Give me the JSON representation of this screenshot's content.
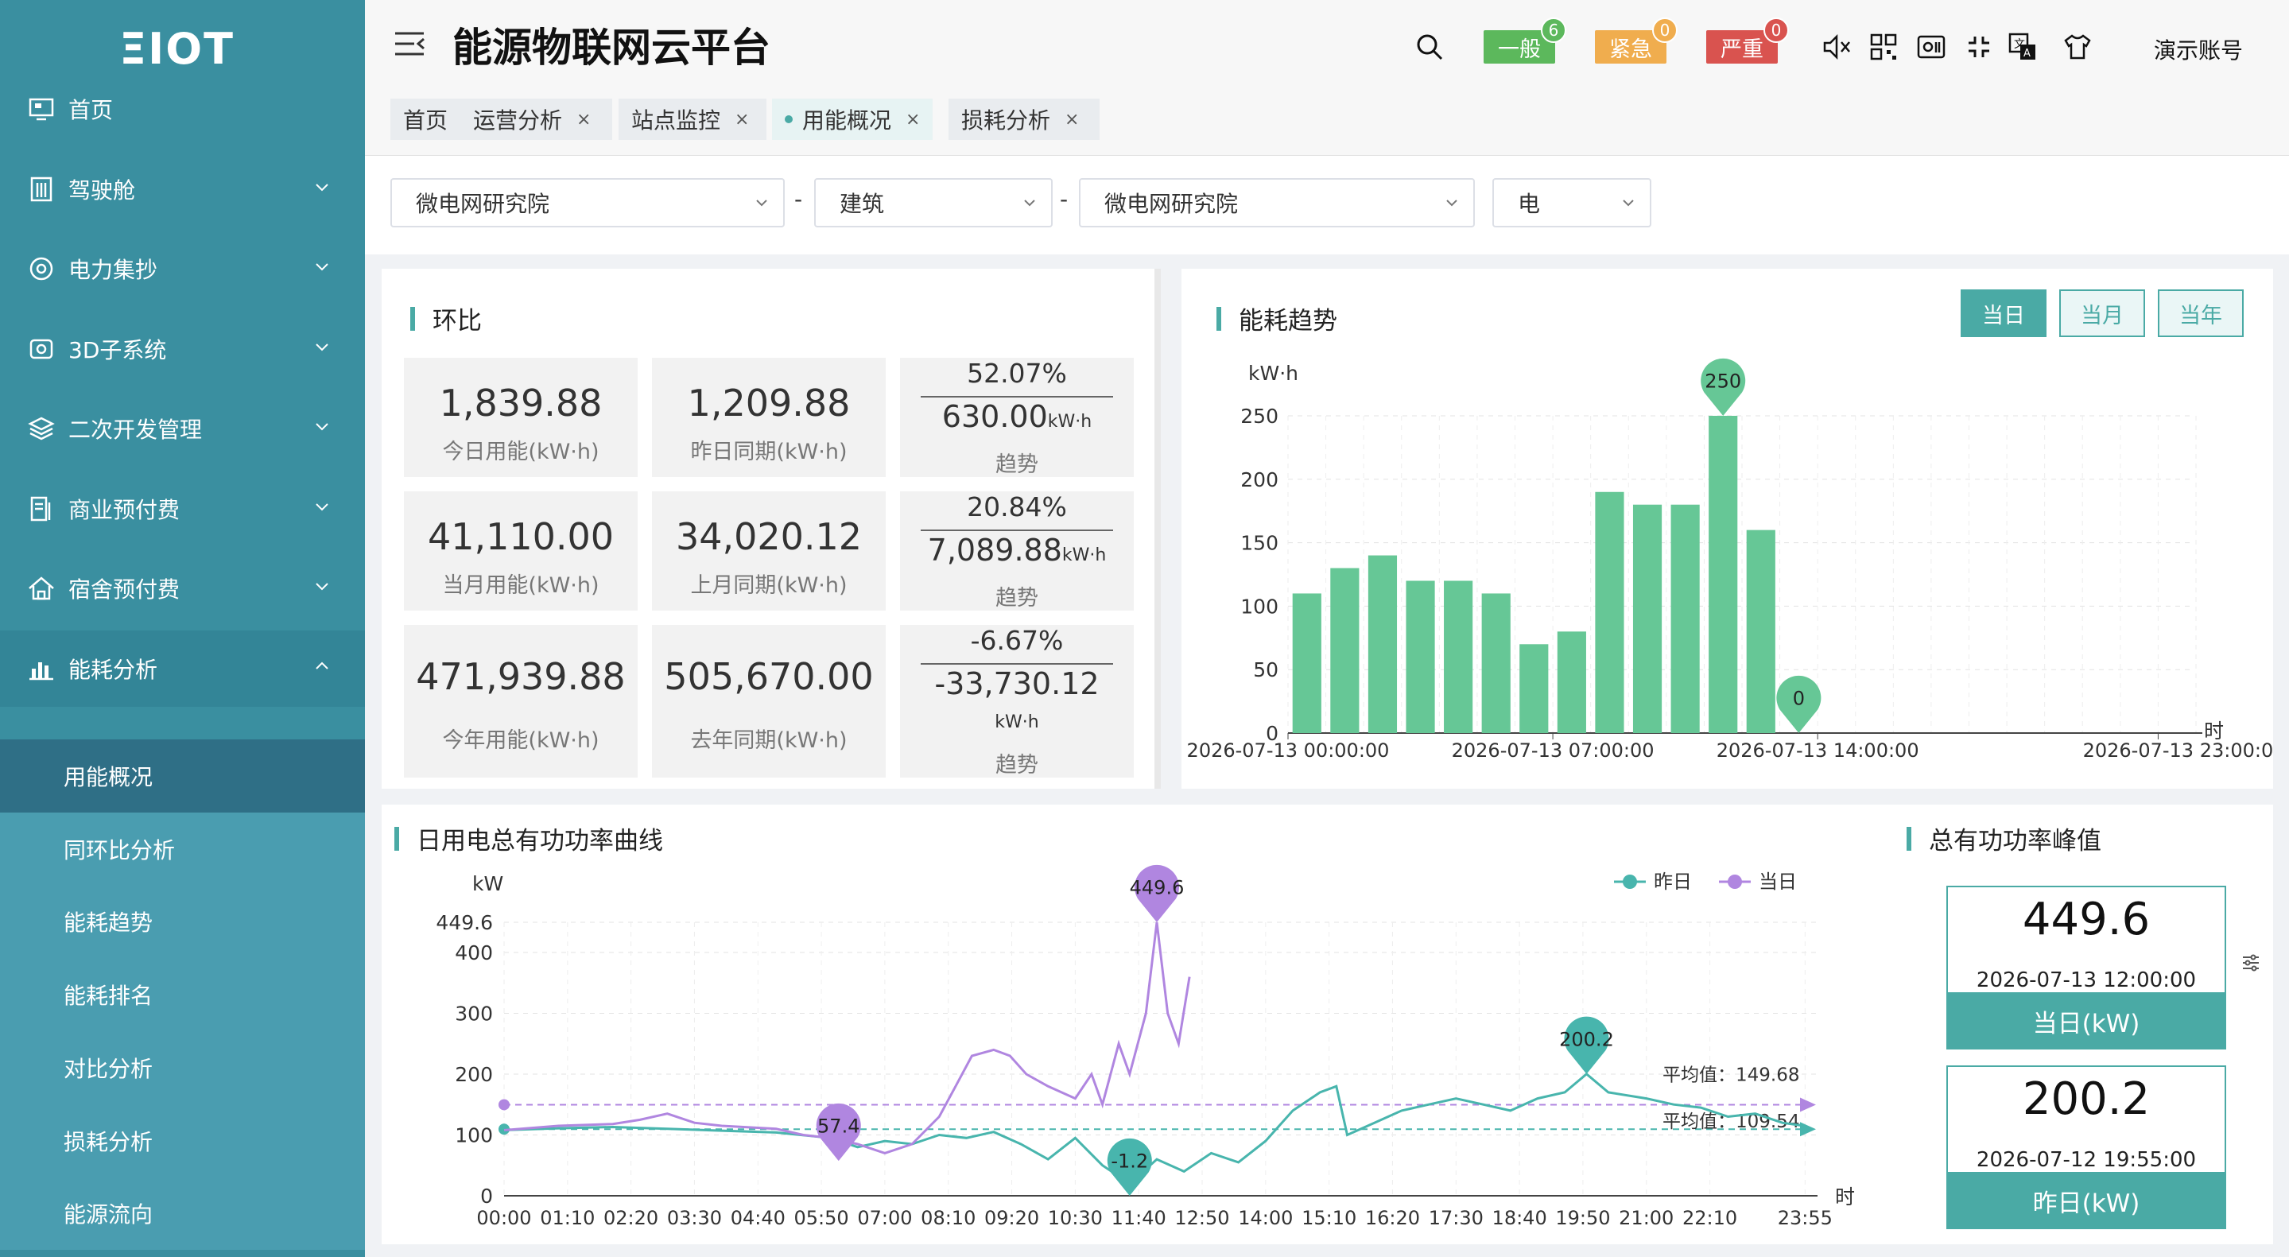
{
  "sidebar": {
    "logo": "ΞIOT",
    "menu": [
      {
        "label": "首页",
        "icon": "monitor-icon",
        "expandable": false
      },
      {
        "label": "驾驶舱",
        "icon": "building-icon",
        "expandable": true
      },
      {
        "label": "电力集抄",
        "icon": "meter-icon",
        "expandable": true
      },
      {
        "label": "3D子系统",
        "icon": "cube-icon",
        "expandable": true
      },
      {
        "label": "二次开发管理",
        "icon": "layers-icon",
        "expandable": true
      },
      {
        "label": "商业预付费",
        "icon": "invoice-icon",
        "expandable": true
      },
      {
        "label": "宿舍预付费",
        "icon": "home-icon",
        "expandable": true
      },
      {
        "label": "能耗分析",
        "icon": "bar-chart-icon",
        "expandable": true,
        "expanded": true
      }
    ],
    "submenu": [
      {
        "label": "用能概况",
        "active": true
      },
      {
        "label": "同环比分析"
      },
      {
        "label": "能耗趋势"
      },
      {
        "label": "能耗排名"
      },
      {
        "label": "对比分析"
      },
      {
        "label": "损耗分析"
      },
      {
        "label": "能源流向"
      }
    ]
  },
  "header": {
    "title": "能源物联网云平台",
    "alarms": [
      {
        "label": "一般",
        "count": "6",
        "color": "#5cb85c"
      },
      {
        "label": "紧急",
        "count": "0",
        "color": "#f0ad4e"
      },
      {
        "label": "严重",
        "count": "0",
        "color": "#d9534f"
      }
    ],
    "account": "演示账号",
    "tabs": [
      {
        "label": "首页",
        "closable": false
      },
      {
        "label": "运营分析",
        "closable": true
      },
      {
        "label": "站点监控",
        "closable": true
      },
      {
        "label": "用能概况",
        "closable": true,
        "active": true
      },
      {
        "label": "损耗分析",
        "closable": true
      }
    ]
  },
  "filters": {
    "site": "微电网研究院",
    "type": "建筑",
    "building": "微电网研究院",
    "energy": "电",
    "separator": "-"
  },
  "ratio": {
    "title": "环比",
    "rows": [
      {
        "cur_value": "1,839.88",
        "cur_label": "今日用能(kW·h)",
        "prev_value": "1,209.88",
        "prev_label": "昨日同期(kW·h)",
        "pct": "52.07%",
        "diff": "630.00",
        "unit": "kW·h",
        "trend_label": "趋势"
      },
      {
        "cur_value": "41,110.00",
        "cur_label": "当月用能(kW·h)",
        "prev_value": "34,020.12",
        "prev_label": "上月同期(kW·h)",
        "pct": "20.84%",
        "diff": "7,089.88",
        "unit": "kW·h",
        "trend_label": "趋势"
      },
      {
        "cur_value": "471,939.88",
        "cur_label": "今年用能(kW·h)",
        "prev_value": "505,670.00",
        "prev_label": "去年同期(kW·h)",
        "pct": "-6.67%",
        "diff": "-33,730.12",
        "unit": "kW·h",
        "trend_label": "趋势"
      }
    ]
  },
  "trend": {
    "title": "能耗趋势",
    "buttons": [
      "当日",
      "当月",
      "当年"
    ],
    "selected": "当日"
  },
  "power": {
    "title": "日用电总有功功率曲线"
  },
  "peak": {
    "title": "总有功功率峰值",
    "cards": [
      {
        "value": "449.6",
        "time": "2026-07-13 12:00:00",
        "label": "当日(kW)"
      },
      {
        "value": "200.2",
        "time": "2026-07-12 19:55:00",
        "label": "昨日(kW)"
      }
    ]
  },
  "chart_data": [
    {
      "type": "bar",
      "title": "能耗趋势",
      "ylabel": "kW·h",
      "xlabel": "时",
      "ylim": [
        0,
        250
      ],
      "yticks": [
        0,
        50,
        100,
        150,
        200,
        250
      ],
      "x_tick_labels": [
        "2026-07-13 00:00:00",
        "2026-07-13 07:00:00",
        "2026-07-13 14:00:00",
        "2026-07-13 23:00:0"
      ],
      "hours": [
        0,
        1,
        2,
        3,
        4,
        5,
        6,
        7,
        8,
        9,
        10,
        11,
        12,
        13,
        14,
        15,
        16,
        17,
        18,
        19,
        20,
        21,
        22,
        23
      ],
      "values": [
        110,
        130,
        140,
        120,
        120,
        110,
        70,
        80,
        190,
        180,
        180,
        250,
        160,
        0
      ],
      "color": "#66c796",
      "markers": [
        {
          "label": "250",
          "hour": 11,
          "value": 250
        },
        {
          "label": "0",
          "hour": 13,
          "value": 0
        }
      ]
    },
    {
      "type": "line",
      "title": "日用电总有功功率曲线",
      "ylabel": "kW",
      "xlabel": "时",
      "ylim": [
        0,
        449.6
      ],
      "yticks": [
        0,
        100,
        200,
        300,
        400
      ],
      "ymax_label": "449.6",
      "x_tick_labels": [
        "00:00",
        "01:10",
        "02:20",
        "03:30",
        "04:40",
        "05:50",
        "07:00",
        "08:10",
        "09:20",
        "10:30",
        "11:40",
        "12:50",
        "14:00",
        "15:10",
        "16:20",
        "17:30",
        "18:40",
        "19:50",
        "21:00",
        "22:10",
        "23:55"
      ],
      "legend": [
        "昨日",
        "当日"
      ],
      "series": [
        {
          "name": "昨日",
          "color": "#48b5ad",
          "points": [
            [
              0,
              108
            ],
            [
              1,
              111
            ],
            [
              2,
              113
            ],
            [
              3,
              110
            ],
            [
              4,
              107
            ],
            [
              5,
              104
            ],
            [
              6,
              95
            ],
            [
              6.5,
              80
            ],
            [
              7,
              90
            ],
            [
              7.5,
              85
            ],
            [
              8,
              100
            ],
            [
              8.5,
              95
            ],
            [
              9,
              105
            ],
            [
              9.5,
              85
            ],
            [
              10,
              60
            ],
            [
              10.5,
              95
            ],
            [
              11,
              50
            ],
            [
              11.5,
              20
            ],
            [
              12,
              60
            ],
            [
              12.5,
              40
            ],
            [
              13,
              70
            ],
            [
              13.5,
              55
            ],
            [
              14,
              90
            ],
            [
              14.5,
              140
            ],
            [
              15,
              170
            ],
            [
              15.3,
              180
            ],
            [
              15.5,
              100
            ],
            [
              16,
              120
            ],
            [
              16.5,
              140
            ],
            [
              17,
              150
            ],
            [
              17.5,
              160
            ],
            [
              18,
              150
            ],
            [
              18.5,
              140
            ],
            [
              19,
              160
            ],
            [
              19.5,
              170
            ],
            [
              19.9,
              200.2
            ],
            [
              20.3,
              170
            ],
            [
              21,
              160
            ],
            [
              21.5,
              150
            ],
            [
              22,
              145
            ],
            [
              22.5,
              130
            ],
            [
              23,
              135
            ],
            [
              23.5,
              120
            ],
            [
              23.9,
              115
            ]
          ],
          "markers": [
            {
              "label": "200.2",
              "x": 19.9,
              "y": 200.2
            },
            {
              "label": "-1.2",
              "x": 11.5,
              "y": -1.2
            }
          ],
          "average_label": "平均值：109.54",
          "average": 109.54
        },
        {
          "name": "当日",
          "color": "#b086e0",
          "points": [
            [
              0,
              108
            ],
            [
              1,
              115
            ],
            [
              2,
              118
            ],
            [
              2.5,
              125
            ],
            [
              3,
              135
            ],
            [
              3.5,
              120
            ],
            [
              4,
              115
            ],
            [
              5,
              110
            ],
            [
              5.5,
              100
            ],
            [
              6,
              95
            ],
            [
              6.5,
              85
            ],
            [
              7,
              70
            ],
            [
              7.5,
              85
            ],
            [
              8,
              130
            ],
            [
              8.3,
              180
            ],
            [
              8.6,
              230
            ],
            [
              9,
              240
            ],
            [
              9.3,
              230
            ],
            [
              9.6,
              200
            ],
            [
              10,
              180
            ],
            [
              10.5,
              160
            ],
            [
              10.8,
              200
            ],
            [
              11,
              150
            ],
            [
              11.3,
              250
            ],
            [
              11.5,
              200
            ],
            [
              11.8,
              300
            ],
            [
              12,
              449.6
            ],
            [
              12.2,
              300
            ],
            [
              12.4,
              250
            ],
            [
              12.6,
              360
            ]
          ],
          "markers": [
            {
              "label": "449.6",
              "x": 12,
              "y": 449.6
            },
            {
              "label": "57.4",
              "x": 6.15,
              "y": 57.4
            }
          ],
          "average_label": "平均值：149.68",
          "average": 149.68
        }
      ]
    }
  ]
}
